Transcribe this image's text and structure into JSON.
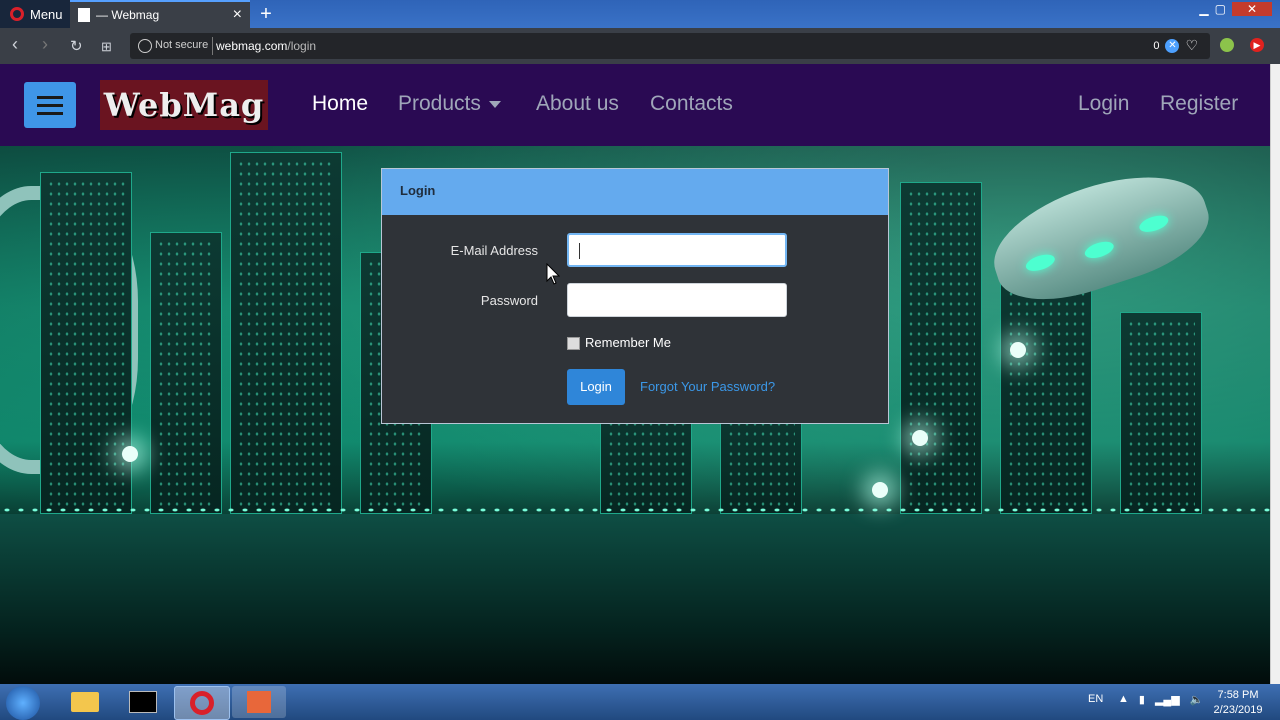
{
  "browser": {
    "menu_label": "Menu",
    "tab_title": "— Webmag",
    "new_tab_symbol": "+",
    "not_secure_label": "Not secure",
    "url_host": "webmag.com",
    "url_path": "/login",
    "blocker_count": "0",
    "window_controls": [
      "minimize",
      "maximize",
      "close"
    ]
  },
  "site": {
    "logo_text": "WebMag",
    "nav": {
      "home": "Home",
      "products": "Products",
      "about": "About us",
      "contacts": "Contacts",
      "login": "Login",
      "register": "Register"
    }
  },
  "login_form": {
    "panel_title": "Login",
    "email_label": "E-Mail Address",
    "email_value": "",
    "password_label": "Password",
    "password_value": "",
    "remember_label": "Remember Me",
    "remember_checked": false,
    "submit_label": "Login",
    "forgot_label": "Forgot Your Password?"
  },
  "taskbar": {
    "language": "EN",
    "time": "7:58 PM",
    "date": "2/23/2019",
    "apps": [
      "file-explorer",
      "command-prompt",
      "opera",
      "powerpoint"
    ]
  },
  "colors": {
    "nav_bg": "#2a0a53",
    "panel_header": "#64aaee",
    "primary_button": "#2f86d9",
    "link": "#3b98e8"
  }
}
